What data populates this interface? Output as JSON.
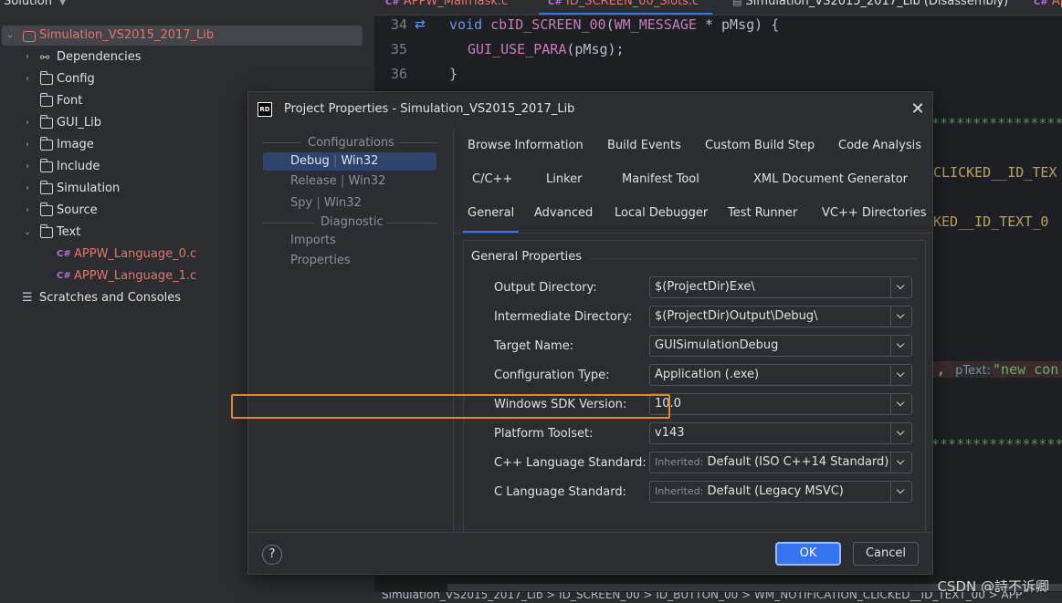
{
  "sidebar": {
    "header": "Solution",
    "items": [
      {
        "label": "Simulation_VS2015_2017_Lib",
        "type": "project"
      },
      {
        "label": "Dependencies",
        "type": "deps"
      },
      {
        "label": "Config",
        "type": "folder"
      },
      {
        "label": "Font",
        "type": "folder"
      },
      {
        "label": "GUI_Lib",
        "type": "folder"
      },
      {
        "label": "Image",
        "type": "folder"
      },
      {
        "label": "Include",
        "type": "folder"
      },
      {
        "label": "Simulation",
        "type": "folder"
      },
      {
        "label": "Source",
        "type": "folder"
      },
      {
        "label": "Text",
        "type": "folder"
      },
      {
        "label": "APPW_Language_0.c",
        "type": "cfile"
      },
      {
        "label": "APPW_Language_1.c",
        "type": "cfile"
      },
      {
        "label": "Scratches and Consoles",
        "type": "scratches"
      }
    ]
  },
  "editor": {
    "tabs": [
      "APPW_MainTask.c",
      "ID_SCREEN_00_Slots.c",
      "Simulation_VS2015_2017_Lib (Disassembly)",
      "Ap"
    ],
    "line_numbers": [
      "34",
      "35",
      "36"
    ],
    "code": {
      "l34_void": "void ",
      "l34_fn": "cbID_SCREEN_00",
      "l34_rest1": "(",
      "l34_type": "WM_MESSAGE",
      "l34_rest2": " * pMsg) {",
      "l35_macro": "GUI_USE_PARA",
      "l35_rest": "(pMsg);",
      "l36": "}",
      "stars1": "*******************",
      "clicked1": "CLICKED__ID_TEX",
      "clicked2": "KED__ID_TEXT_0",
      "hint_comma": ",",
      "hint_label": "pText:",
      "hint_str": "\"new con",
      "stars2": "*******************"
    },
    "status": "Simulation_VS2015_2017_Lib  >  ID_SCREEN_00  >  ID_BUTTON_00  >  WM_NOTIFICATION_CLICKED__ID_TEXT_00  >  APP",
    "watermark": "CSDN @詩不诉卿"
  },
  "dialog": {
    "title": "Project Properties - Simulation_VS2015_2017_Lib",
    "logo": "RD",
    "configurations_header": "Configurations",
    "configs": [
      {
        "name": "Debug",
        "platform": "Win32",
        "selected": true
      },
      {
        "name": "Release",
        "platform": "Win32",
        "selected": false
      },
      {
        "name": "Spy",
        "platform": "Win32",
        "selected": false
      }
    ],
    "diagnostic_header": "Diagnostic",
    "diagnostic_items": [
      "Imports",
      "Properties"
    ],
    "tabs_row1": [
      "Browse Information",
      "Build Events",
      "Custom Build Step",
      "Code Analysis"
    ],
    "tabs_row2": [
      "C/C++",
      "Linker",
      "Manifest Tool",
      "XML Document Generator"
    ],
    "tabs_row3": [
      "General",
      "Advanced",
      "Local Debugger",
      "Test Runner",
      "VC++ Directories"
    ],
    "active_tab": "General",
    "section_title": "General Properties",
    "properties": [
      {
        "label": "Output Directory:",
        "value": "$(ProjectDir)Exe\\",
        "inherited": ""
      },
      {
        "label": "Intermediate Directory:",
        "value": "$(ProjectDir)Output\\Debug\\",
        "inherited": ""
      },
      {
        "label": "Target Name:",
        "value": "GUISimulationDebug",
        "inherited": ""
      },
      {
        "label": "Configuration Type:",
        "value": "Application (.exe)",
        "inherited": ""
      },
      {
        "label": "Windows SDK Version:",
        "value": "10.0",
        "inherited": ""
      },
      {
        "label": "Platform Toolset:",
        "value": "v143",
        "inherited": ""
      },
      {
        "label": "C++ Language Standard:",
        "value": "Default (ISO C++14 Standard)",
        "inherited": "Inherited:"
      },
      {
        "label": "C Language Standard:",
        "value": "Default (Legacy MSVC)",
        "inherited": "Inherited:"
      }
    ],
    "highlighted_property": "Windows SDK Version:",
    "highlight_color": "#e3872d",
    "help_label": "?",
    "ok_label": "OK",
    "cancel_label": "Cancel"
  }
}
